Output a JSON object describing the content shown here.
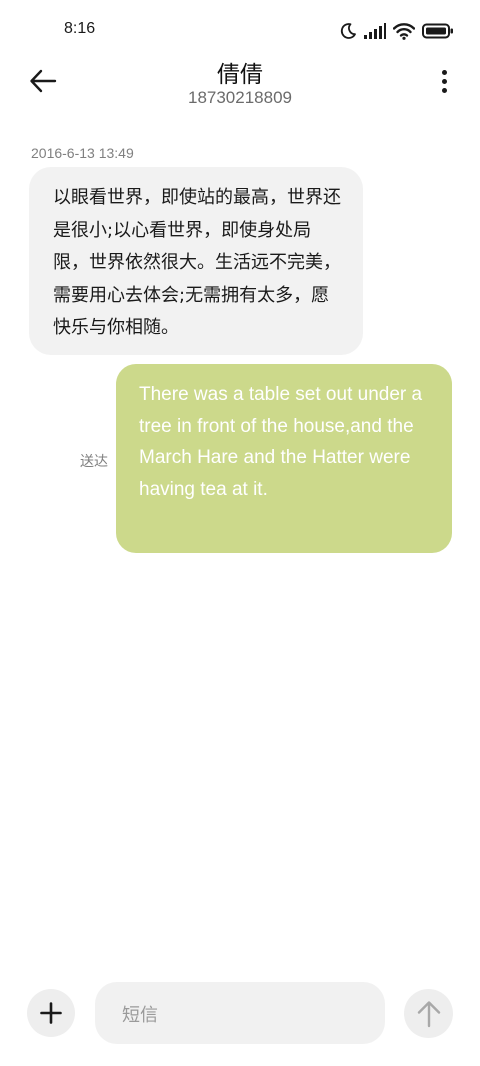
{
  "status_bar": {
    "time": "8:16",
    "icons": [
      "moon-icon",
      "signal-icon",
      "wifi-icon",
      "battery-icon"
    ]
  },
  "header": {
    "contact_name": "倩倩",
    "contact_number": "18730218809",
    "back_icon": "arrow-left-icon",
    "menu_icon": "more-vertical-icon"
  },
  "conversation": {
    "timestamp": "2016-6-13 13:49",
    "incoming_message": "以眼看世界，即使站的最高，世界还是很小;以心看世界，即使身处局限，世界依然很大。生活远不完美，需要用心去体会;无需拥有太多，愿快乐与你相随。",
    "outgoing_message": "There was a table set out under a tree in front of the house,and the March Hare and the Hatter were having tea at it.",
    "outgoing_status": "送达"
  },
  "composer": {
    "placeholder": "短信",
    "add_icon": "plus-icon",
    "send_icon": "arrow-up-icon"
  },
  "colors": {
    "outgoing_bubble": "#ccd98b",
    "incoming_bubble": "#f2f2f2",
    "muted_text": "#808080"
  }
}
